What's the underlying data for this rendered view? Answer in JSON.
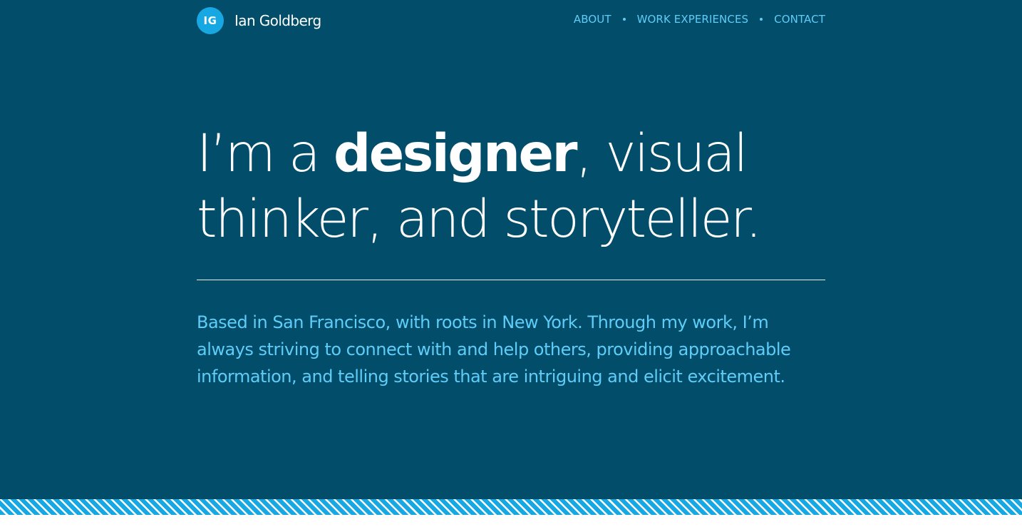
{
  "header": {
    "logo_initials": "IG",
    "brand_name": "Ian Goldberg",
    "nav": [
      {
        "label": "ABOUT"
      },
      {
        "label": "WORK EXPERIENCES"
      },
      {
        "label": "CONTACT"
      }
    ]
  },
  "hero": {
    "headline_part1": "I’m a ",
    "headline_strong": "designer",
    "headline_part2": ", visual thinker, and storyteller.",
    "intro": "Based in San Francisco, with roots in New York. Through my work, I’m always striving to connect with and help others, providing approachable information, and telling stories that are intriguing and elicit excitement."
  },
  "colors": {
    "background": "#024d69",
    "accent": "#17a8e3",
    "link": "#5fcdf8",
    "text": "#ffffff"
  }
}
